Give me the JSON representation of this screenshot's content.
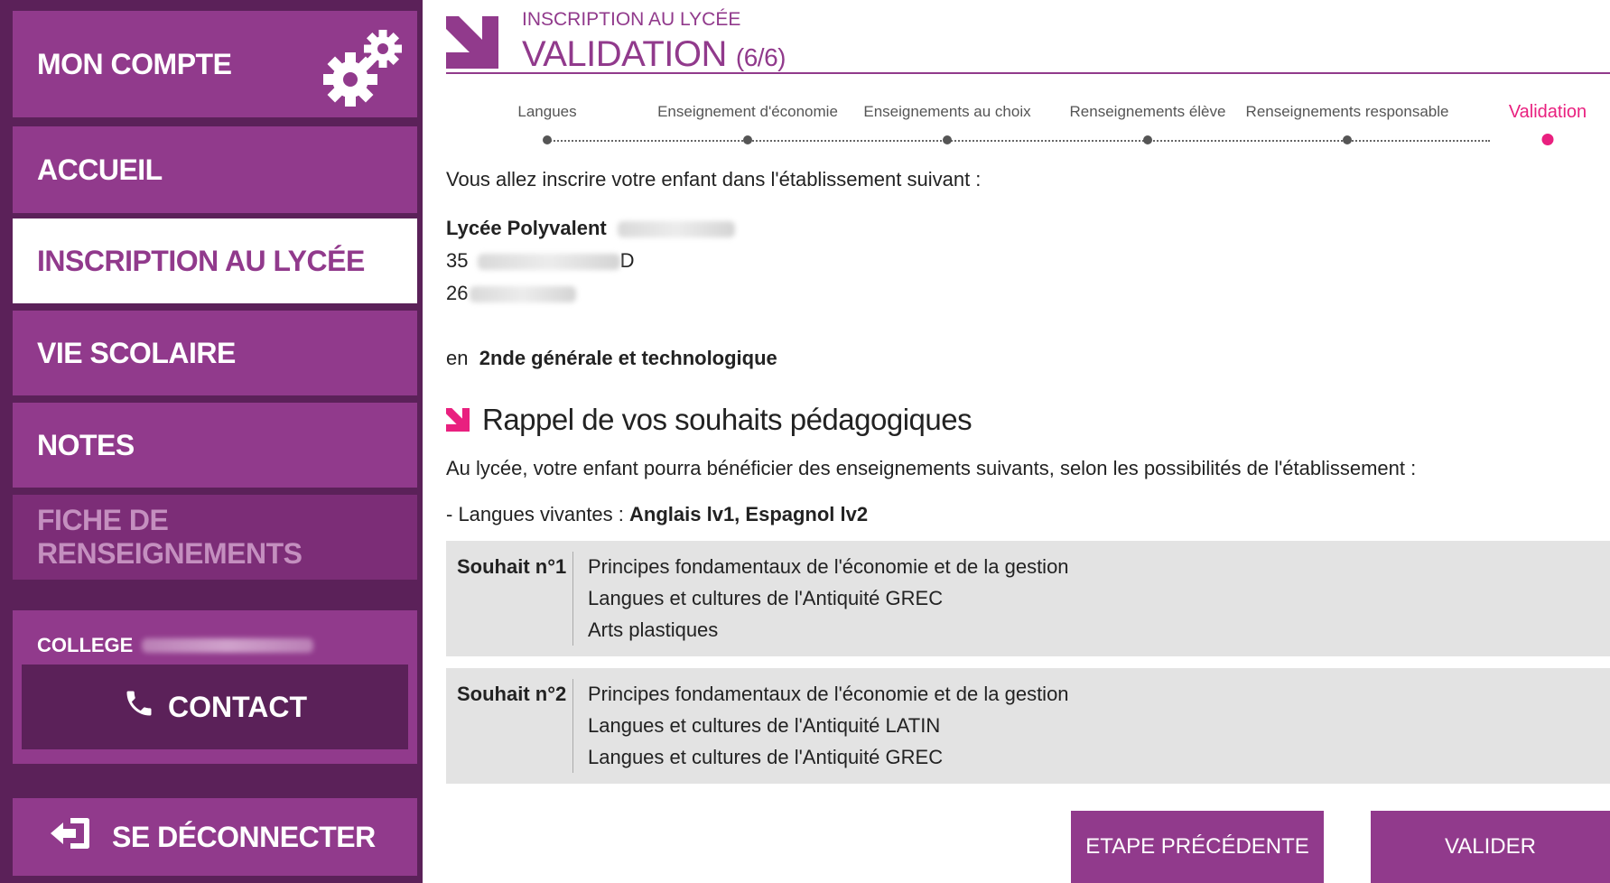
{
  "sidebar": {
    "account_label": "MON COMPTE",
    "items": [
      {
        "label": "ACCUEIL"
      },
      {
        "label": "INSCRIPTION AU LYCÉE"
      },
      {
        "label": "VIE SCOLAIRE"
      },
      {
        "label": "NOTES"
      },
      {
        "label": "FICHE DE RENSEIGNEMENTS"
      }
    ],
    "college_label": "COLLEGE",
    "contact_label": "CONTACT",
    "logout_label": "SE DÉCONNECTER"
  },
  "header": {
    "subtitle": "INSCRIPTION AU LYCÉE",
    "title": "VALIDATION",
    "step": "(6/6)"
  },
  "steps": [
    {
      "label": "Langues"
    },
    {
      "label": "Enseignement d'économie"
    },
    {
      "label": "Enseignements au choix"
    },
    {
      "label": "Renseignements élève"
    },
    {
      "label": "Renseignements responsable"
    },
    {
      "label": "Validation",
      "current": true
    }
  ],
  "content": {
    "intro": "Vous allez inscrire votre enfant dans l'établissement suivant :",
    "school_name": "Lycée Polyvalent",
    "address_number": "35",
    "address_end": "D",
    "postal_prefix": "26",
    "class_prefix": "en",
    "class_name": "2nde générale et technologique",
    "section_title": "Rappel de vos souhaits pédagogiques",
    "section_intro": "Au lycée, votre enfant pourra bénéficier des enseignements suivants, selon les possibilités de l'établissement :",
    "languages_prefix": "- Langues vivantes :",
    "languages_value": "Anglais lv1, Espagnol lv2"
  },
  "wishes": [
    {
      "label": "Souhait n°1",
      "items": [
        "Principes fondamentaux de l'économie et de la gestion",
        "Langues et cultures de l'Antiquité GREC",
        "Arts plastiques"
      ]
    },
    {
      "label": "Souhait n°2",
      "items": [
        "Principes fondamentaux de l'économie et de la gestion",
        "Langues et cultures de l'Antiquité LATIN",
        "Langues et cultures de l'Antiquité GREC"
      ]
    }
  ],
  "buttons": {
    "previous": "ETAPE PRÉCÉDENTE",
    "validate": "VALIDER"
  },
  "colors": {
    "sidebar_bg": "#5b2159",
    "item_bg": "#913a8c",
    "accent_pink": "#e9207f",
    "wish_bg": "#e3e3e3"
  },
  "icons": [
    "gears-icon",
    "phone-icon",
    "logout-icon",
    "arrow-down-right-icon"
  ]
}
